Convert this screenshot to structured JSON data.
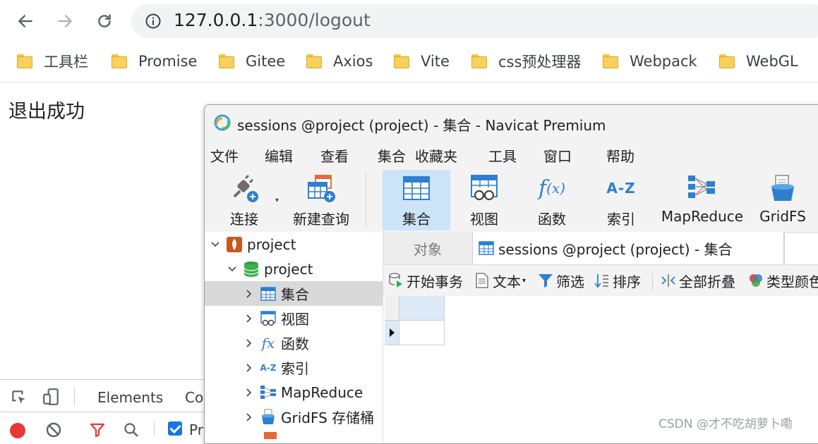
{
  "browser": {
    "url_host": "127.0.0.1",
    "url_rest": ":3000/logout",
    "bookmarks": [
      "工具栏",
      "Promise",
      "Gitee",
      "Axios",
      "Vite",
      "css预处理器",
      "Webpack",
      "WebGL"
    ]
  },
  "page": {
    "text": "退出成功"
  },
  "devtools": {
    "tabs": [
      "Elements",
      "Co"
    ],
    "preserve_label": "Pr"
  },
  "navicat": {
    "title": "sessions @project (project) - 集合 - Navicat Premium",
    "menu": [
      "文件",
      "编辑",
      "查看",
      "集合",
      "收藏夹",
      "工具",
      "窗口",
      "帮助"
    ],
    "toolbar": {
      "connect": "连接",
      "new_query": "新建查询",
      "collection": "集合",
      "view": "视图",
      "function": "函数",
      "index": "索引",
      "mapreduce": "MapReduce",
      "gridfs": "GridFS"
    },
    "tree": {
      "connection": "project",
      "database": "project",
      "items": [
        "集合",
        "视图",
        "函数",
        "索引",
        "MapReduce",
        "GridFS 存储桶"
      ]
    },
    "tabs": {
      "objects": "对象",
      "active": "sessions @project (project) - 集合"
    },
    "subtoolbar": {
      "begin_tx": "开始事务",
      "text": "文本",
      "filter": "筛选",
      "sort": "排序",
      "collapse_all": "全部折叠",
      "type_color": "类型颜色"
    }
  },
  "watermark": "CSDN @才不吃胡萝卜嘞",
  "colors": {
    "accent_blue": "#1a73e8",
    "navicat_active": "#cce4f7",
    "folder": "#f7d15a"
  }
}
